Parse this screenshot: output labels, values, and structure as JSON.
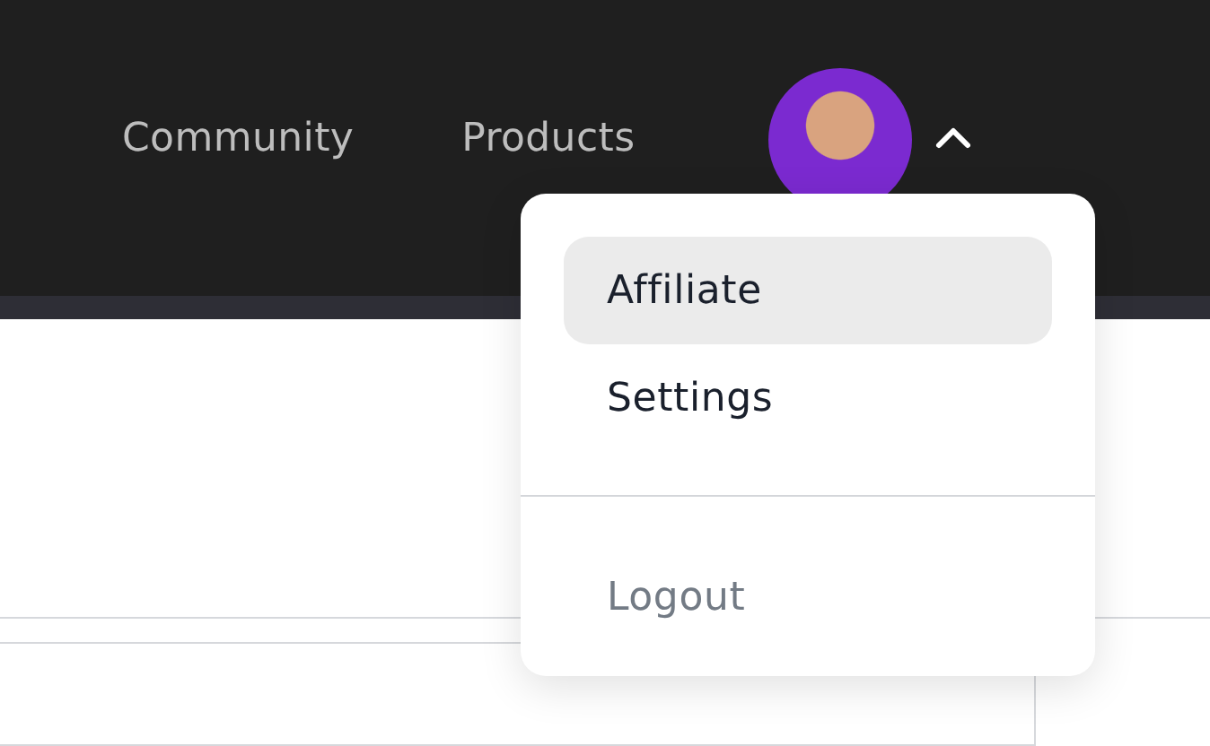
{
  "nav": {
    "links": [
      {
        "label": "Community"
      },
      {
        "label": "Products"
      }
    ]
  },
  "account_menu": {
    "expanded": true,
    "items": [
      {
        "label": "Affiliate",
        "selected": true
      },
      {
        "label": "Settings",
        "selected": false
      }
    ],
    "footer_items": [
      {
        "label": "Logout"
      }
    ]
  }
}
